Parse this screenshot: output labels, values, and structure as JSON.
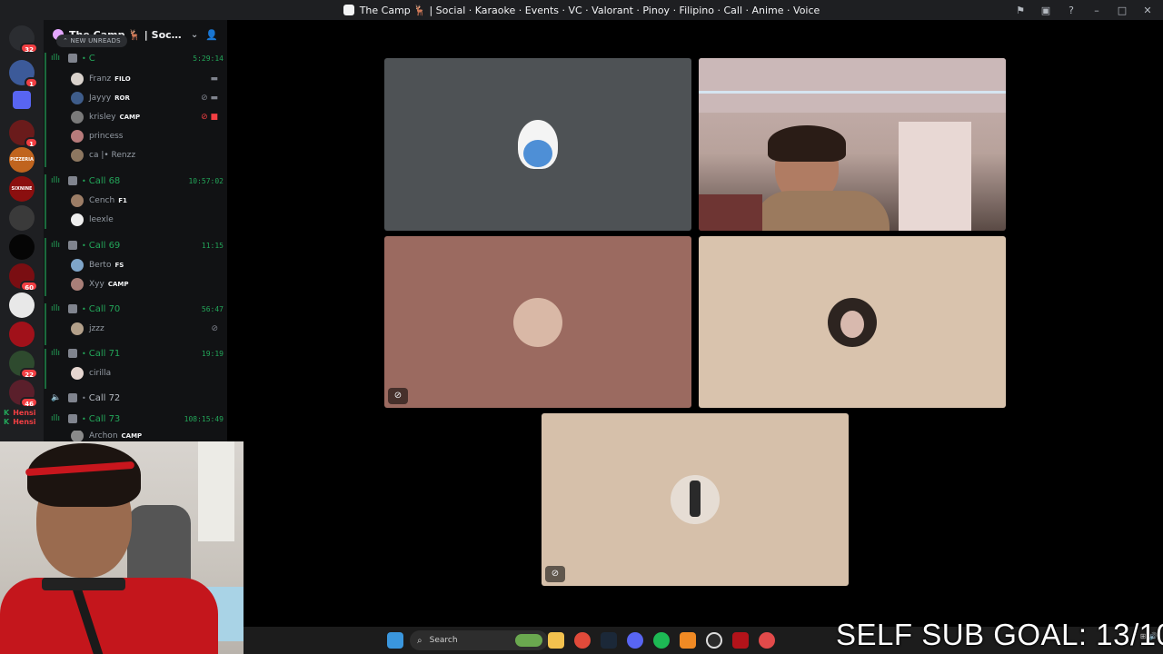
{
  "window": {
    "title": "The Camp 🦌 | Social · Karaoke · Events · VC · Valorant · Pinoy · Filipino · Call · Anime · Voice"
  },
  "server_rail": {
    "home_badge": "32",
    "badges": [
      "1",
      "1",
      "60",
      "22",
      "46"
    ],
    "labels": [
      "PIZZERIA",
      "SIXNINE"
    ]
  },
  "sidebar": {
    "server_name": "The Camp 🦌 | Social · ...",
    "new_unreads": "NEW UNREADS",
    "channels": [
      {
        "name": "C",
        "time": "5:29:14",
        "users": [
          {
            "name": "Franz",
            "tag": "FILO"
          },
          {
            "name": "Jayyy",
            "tag": "ROR"
          },
          {
            "name": "krisley",
            "tag": "CAMP"
          },
          {
            "name": "princess",
            "tag": ""
          },
          {
            "name": "ca |• Renzz",
            "tag": ""
          }
        ]
      },
      {
        "name": "Call 68",
        "time": "10:57:02",
        "users": [
          {
            "name": "Cench",
            "tag": "F1"
          },
          {
            "name": "leexle",
            "tag": ""
          }
        ]
      },
      {
        "name": "Call 69",
        "time": "11:15",
        "users": [
          {
            "name": "Berto",
            "tag": "FS"
          },
          {
            "name": "Xyy",
            "tag": "CAMP"
          }
        ]
      },
      {
        "name": "Call 70",
        "time": "56:47",
        "users": [
          {
            "name": "jzzz",
            "tag": ""
          }
        ]
      },
      {
        "name": "Call 71",
        "time": "19:19",
        "users": [
          {
            "name": "cirilla",
            "tag": ""
          }
        ]
      },
      {
        "name": "Call 72",
        "time": "",
        "users": []
      },
      {
        "name": "Call 73",
        "time": "108:15:49",
        "users": [
          {
            "name": "Archon",
            "tag": "CAMP"
          }
        ]
      }
    ]
  },
  "stream_overlay": {
    "chat_name": "Hensi",
    "goal_text": "SELF SUB GOAL: 13/10"
  },
  "taskbar": {
    "search_placeholder": "Search"
  },
  "colors": {
    "tile_gray": "#4e5255",
    "tile_rose": "#9b6a60",
    "tile_beige": "#d9c3ad",
    "tile_beige2": "#d6c0aa",
    "voice_green": "#23a559"
  }
}
